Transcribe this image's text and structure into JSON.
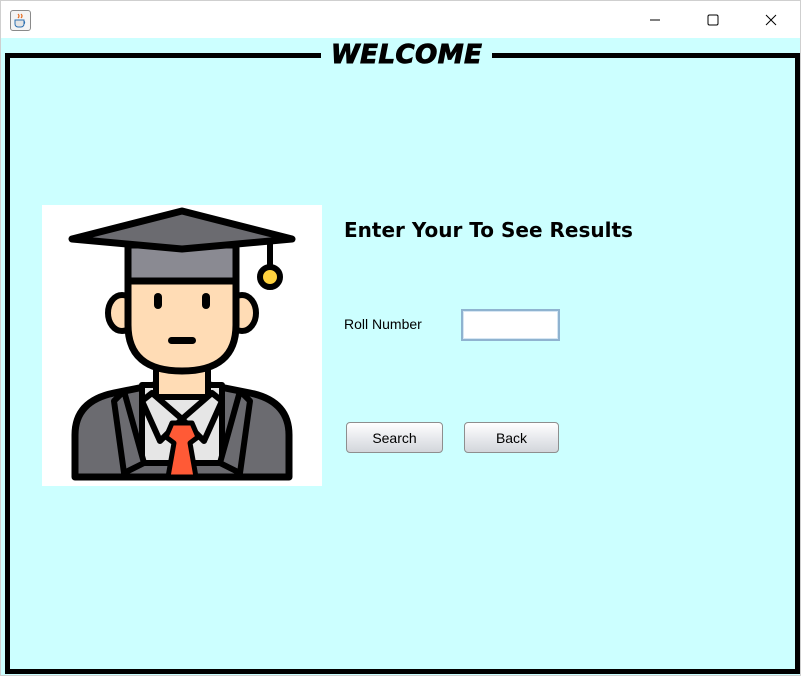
{
  "window": {
    "app_icon": "java-cup-icon",
    "controls": {
      "minimize": "minimize-icon",
      "maximize": "maximize-icon",
      "close": "close-icon"
    }
  },
  "frame": {
    "title": "WELCOME"
  },
  "form": {
    "heading": "Enter Your To See Results",
    "roll_label": "Roll Number",
    "roll_value": "",
    "search_label": "Search",
    "back_label": "Back"
  },
  "illustration": {
    "icon": "graduate-student-icon"
  },
  "colors": {
    "background": "#ccffff",
    "border": "#000000",
    "tie": "#ff5a36",
    "skin": "#ffdcb5",
    "cap": "#6f6f74"
  }
}
